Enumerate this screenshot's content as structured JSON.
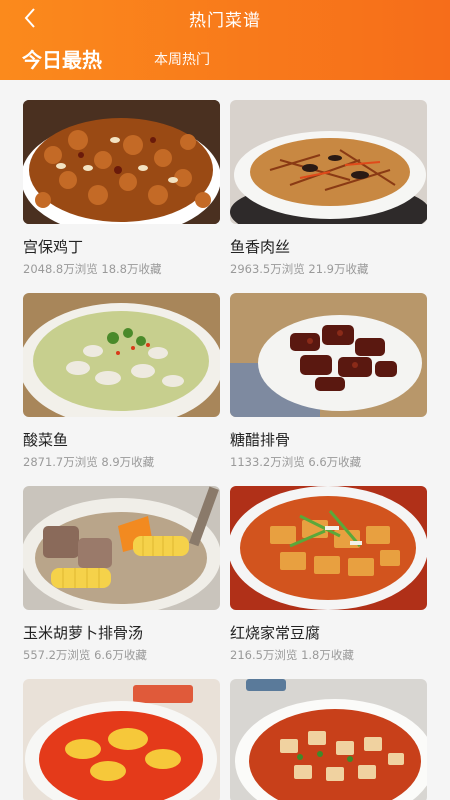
{
  "header": {
    "title": "热门菜谱",
    "tabs": [
      {
        "label": "今日最热",
        "active": true
      },
      {
        "label": "本周热门",
        "active": false
      }
    ],
    "accent_color": "#f97a1d"
  },
  "recipes": [
    {
      "name": "宫保鸡丁",
      "stats": "2048.8万浏览 18.8万收藏"
    },
    {
      "name": "鱼香肉丝",
      "stats": "2963.5万浏览 21.9万收藏"
    },
    {
      "name": "酸菜鱼",
      "stats": "2871.7万浏览 8.9万收藏"
    },
    {
      "name": "糖醋排骨",
      "stats": "1133.2万浏览 6.6万收藏"
    },
    {
      "name": "玉米胡萝卜排骨汤",
      "stats": "557.2万浏览 6.6万收藏"
    },
    {
      "name": "红烧家常豆腐",
      "stats": "216.5万浏览 1.8万收藏"
    },
    {
      "name": "",
      "stats": ""
    },
    {
      "name": "",
      "stats": ""
    }
  ]
}
